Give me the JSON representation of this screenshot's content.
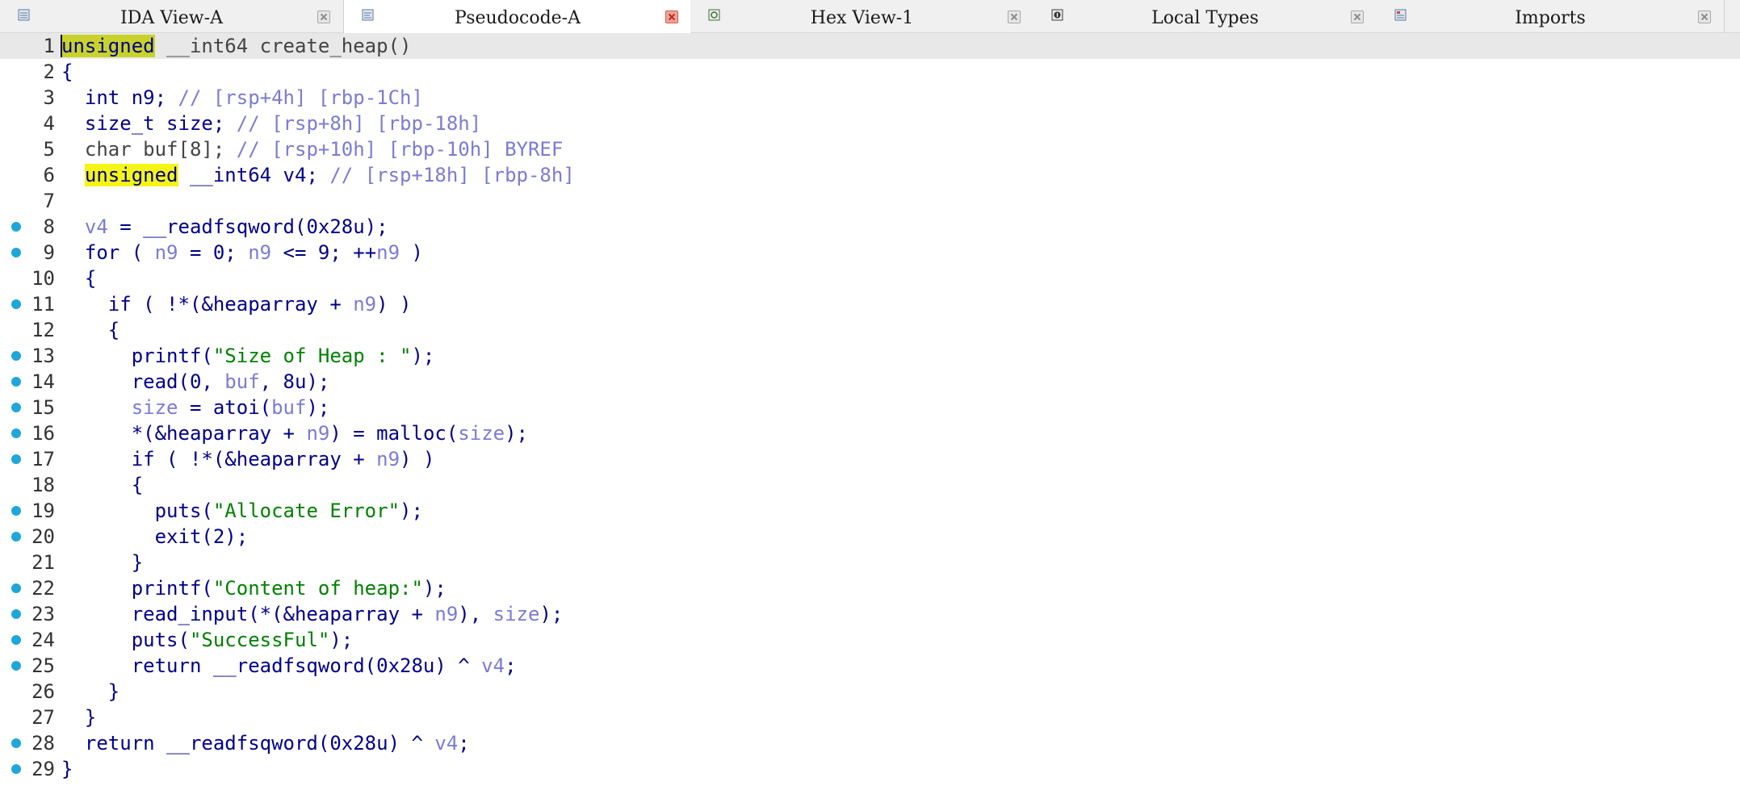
{
  "tabs": [
    {
      "label": "IDA View-A",
      "active": false,
      "icon": "ida-view-icon"
    },
    {
      "label": "Pseudocode-A",
      "active": true,
      "icon": "pseudocode-icon"
    },
    {
      "label": "Hex View-1",
      "active": false,
      "icon": "hex-view-icon"
    },
    {
      "label": "Local Types",
      "active": false,
      "icon": "local-types-icon"
    },
    {
      "label": "Imports",
      "active": false,
      "icon": "imports-icon"
    }
  ],
  "colors": {
    "breakpoint_dot": "#1ea7d8",
    "highlight": "#f5f515",
    "comment": "#7b7bd6",
    "string": "#008000",
    "keyword": "#00008b"
  },
  "code": {
    "lines": [
      {
        "n": "1",
        "dot": false,
        "current": true,
        "tokens": [
          {
            "t": "unsigned",
            "c": "hl1"
          },
          {
            "t": " __int64 create_heap()",
            "c": "gray"
          }
        ]
      },
      {
        "n": "2",
        "dot": false,
        "tokens": [
          {
            "t": "{",
            "c": "kw"
          }
        ]
      },
      {
        "n": "3",
        "dot": false,
        "tokens": [
          {
            "t": "  int n9; ",
            "c": "kw"
          },
          {
            "t": "// [rsp+4h] [rbp-1Ch]",
            "c": "cm"
          }
        ]
      },
      {
        "n": "4",
        "dot": false,
        "tokens": [
          {
            "t": "  size_t size; ",
            "c": "kw"
          },
          {
            "t": "// [rsp+8h] [rbp-18h]",
            "c": "cm"
          }
        ]
      },
      {
        "n": "5",
        "dot": false,
        "tokens": [
          {
            "t": "  char buf[8]; ",
            "c": "gray"
          },
          {
            "t": "// [rsp+10h] [rbp-10h] BYREF",
            "c": "cm"
          }
        ]
      },
      {
        "n": "6",
        "dot": false,
        "tokens": [
          {
            "t": "  ",
            "c": "kw"
          },
          {
            "t": "unsigned",
            "c": "hl"
          },
          {
            "t": " __int64 v4; ",
            "c": "kw"
          },
          {
            "t": "// [rsp+18h] [rbp-8h]",
            "c": "cm"
          }
        ]
      },
      {
        "n": "7",
        "dot": false,
        "tokens": [
          {
            "t": "",
            "c": "kw"
          }
        ]
      },
      {
        "n": "8",
        "dot": true,
        "tokens": [
          {
            "t": "  ",
            "c": "kw"
          },
          {
            "t": "v4",
            "c": "var"
          },
          {
            "t": " = __readfsqword(0x28u);",
            "c": "kw"
          }
        ]
      },
      {
        "n": "9",
        "dot": true,
        "tokens": [
          {
            "t": "  for ( ",
            "c": "kw"
          },
          {
            "t": "n9",
            "c": "var"
          },
          {
            "t": " = 0; ",
            "c": "kw"
          },
          {
            "t": "n9",
            "c": "var"
          },
          {
            "t": " <= 9; ++",
            "c": "kw"
          },
          {
            "t": "n9",
            "c": "var"
          },
          {
            "t": " )",
            "c": "kw"
          }
        ]
      },
      {
        "n": "10",
        "dot": false,
        "tokens": [
          {
            "t": "  {",
            "c": "kw"
          }
        ]
      },
      {
        "n": "11",
        "dot": true,
        "tokens": [
          {
            "t": "    if ( !*(&heaparray + ",
            "c": "kw"
          },
          {
            "t": "n9",
            "c": "var"
          },
          {
            "t": ") )",
            "c": "kw"
          }
        ]
      },
      {
        "n": "12",
        "dot": false,
        "tokens": [
          {
            "t": "    {",
            "c": "kw"
          }
        ]
      },
      {
        "n": "13",
        "dot": true,
        "tokens": [
          {
            "t": "      printf(",
            "c": "kw"
          },
          {
            "t": "\"Size of Heap : \"",
            "c": "str"
          },
          {
            "t": ");",
            "c": "kw"
          }
        ]
      },
      {
        "n": "14",
        "dot": true,
        "tokens": [
          {
            "t": "      read(0, ",
            "c": "kw"
          },
          {
            "t": "buf",
            "c": "var"
          },
          {
            "t": ", 8u);",
            "c": "kw"
          }
        ]
      },
      {
        "n": "15",
        "dot": true,
        "tokens": [
          {
            "t": "      ",
            "c": "kw"
          },
          {
            "t": "size",
            "c": "var"
          },
          {
            "t": " = atoi(",
            "c": "kw"
          },
          {
            "t": "buf",
            "c": "var"
          },
          {
            "t": ");",
            "c": "kw"
          }
        ]
      },
      {
        "n": "16",
        "dot": true,
        "tokens": [
          {
            "t": "      *(&heaparray + ",
            "c": "kw"
          },
          {
            "t": "n9",
            "c": "var"
          },
          {
            "t": ") = malloc(",
            "c": "kw"
          },
          {
            "t": "size",
            "c": "var"
          },
          {
            "t": ");",
            "c": "kw"
          }
        ]
      },
      {
        "n": "17",
        "dot": true,
        "tokens": [
          {
            "t": "      if ( !*(&heaparray + ",
            "c": "kw"
          },
          {
            "t": "n9",
            "c": "var"
          },
          {
            "t": ") )",
            "c": "kw"
          }
        ]
      },
      {
        "n": "18",
        "dot": false,
        "tokens": [
          {
            "t": "      {",
            "c": "kw"
          }
        ]
      },
      {
        "n": "19",
        "dot": true,
        "tokens": [
          {
            "t": "        puts(",
            "c": "kw"
          },
          {
            "t": "\"Allocate Error\"",
            "c": "str"
          },
          {
            "t": ");",
            "c": "kw"
          }
        ]
      },
      {
        "n": "20",
        "dot": true,
        "tokens": [
          {
            "t": "        exit(2);",
            "c": "kw"
          }
        ]
      },
      {
        "n": "21",
        "dot": false,
        "tokens": [
          {
            "t": "      }",
            "c": "kw"
          }
        ]
      },
      {
        "n": "22",
        "dot": true,
        "tokens": [
          {
            "t": "      printf(",
            "c": "kw"
          },
          {
            "t": "\"Content of heap:\"",
            "c": "str"
          },
          {
            "t": ");",
            "c": "kw"
          }
        ]
      },
      {
        "n": "23",
        "dot": true,
        "tokens": [
          {
            "t": "      read_input(*(&heaparray + ",
            "c": "kw"
          },
          {
            "t": "n9",
            "c": "var"
          },
          {
            "t": "), ",
            "c": "kw"
          },
          {
            "t": "size",
            "c": "var"
          },
          {
            "t": ");",
            "c": "kw"
          }
        ]
      },
      {
        "n": "24",
        "dot": true,
        "tokens": [
          {
            "t": "      puts(",
            "c": "kw"
          },
          {
            "t": "\"SuccessFul\"",
            "c": "str"
          },
          {
            "t": ");",
            "c": "kw"
          }
        ]
      },
      {
        "n": "25",
        "dot": true,
        "tokens": [
          {
            "t": "      return __readfsqword(0x28u) ^ ",
            "c": "kw"
          },
          {
            "t": "v4",
            "c": "var"
          },
          {
            "t": ";",
            "c": "kw"
          }
        ]
      },
      {
        "n": "26",
        "dot": false,
        "tokens": [
          {
            "t": "    }",
            "c": "kw"
          }
        ]
      },
      {
        "n": "27",
        "dot": false,
        "tokens": [
          {
            "t": "  }",
            "c": "kw"
          }
        ]
      },
      {
        "n": "28",
        "dot": true,
        "tokens": [
          {
            "t": "  return __readfsqword(0x28u) ^ ",
            "c": "kw"
          },
          {
            "t": "v4",
            "c": "var"
          },
          {
            "t": ";",
            "c": "kw"
          }
        ]
      },
      {
        "n": "29",
        "dot": true,
        "tokens": [
          {
            "t": "}",
            "c": "kw"
          }
        ]
      }
    ]
  }
}
